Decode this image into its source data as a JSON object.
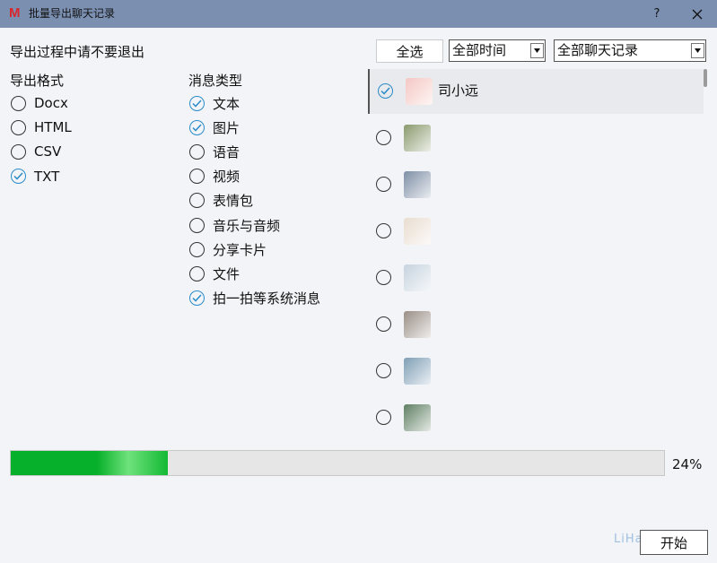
{
  "window": {
    "title": "批量导出聊天记录",
    "logo": "M",
    "help_label": "?",
    "close_label": "✕"
  },
  "hint": "导出过程中请不要退出",
  "format": {
    "heading": "导出格式",
    "options": [
      {
        "label": "Docx",
        "checked": false
      },
      {
        "label": "HTML",
        "checked": false
      },
      {
        "label": "CSV",
        "checked": false
      },
      {
        "label": "TXT",
        "checked": true
      }
    ]
  },
  "types": {
    "heading": "消息类型",
    "options": [
      {
        "label": "文本",
        "checked": true
      },
      {
        "label": "图片",
        "checked": true
      },
      {
        "label": "语音",
        "checked": false
      },
      {
        "label": "视频",
        "checked": false
      },
      {
        "label": "表情包",
        "checked": false
      },
      {
        "label": "音乐与音频",
        "checked": false
      },
      {
        "label": "分享卡片",
        "checked": false
      },
      {
        "label": "文件",
        "checked": false
      },
      {
        "label": "拍一拍等系统消息",
        "checked": true
      }
    ]
  },
  "toolbar": {
    "select_all": "全选",
    "time_filter": "全部时间",
    "record_filter": "全部聊天记录"
  },
  "chats": [
    {
      "name": "司小远",
      "checked": true,
      "selected": true,
      "avatar_color": "#f4c7c3"
    },
    {
      "name": "",
      "checked": false,
      "selected": false,
      "avatar_color": "#8a9a6e"
    },
    {
      "name": "",
      "checked": false,
      "selected": false,
      "avatar_color": "#7e8fa6"
    },
    {
      "name": "",
      "checked": false,
      "selected": false,
      "avatar_color": "#e9ddd0"
    },
    {
      "name": "",
      "checked": false,
      "selected": false,
      "avatar_color": "#c6d3df"
    },
    {
      "name": "",
      "checked": false,
      "selected": false,
      "avatar_color": "#9a8f86"
    },
    {
      "name": "",
      "checked": false,
      "selected": false,
      "avatar_color": "#7f9fb6"
    },
    {
      "name": "",
      "checked": false,
      "selected": false,
      "avatar_color": "#5f7f63"
    }
  ],
  "progress": {
    "value": 24,
    "text": "24%"
  },
  "watermark": "LiHaiBlog.cn",
  "start_label": "开始",
  "colors": {
    "title_bar": "#7b8fb1",
    "check_accent": "#2a8bc9",
    "progress": "#07b02a"
  }
}
